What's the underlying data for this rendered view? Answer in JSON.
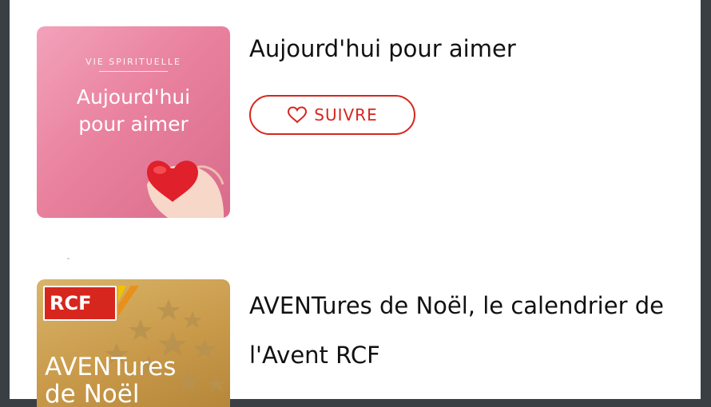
{
  "colors": {
    "accent": "#d7261e",
    "background": "#ffffff",
    "frame": "#3a3f44",
    "title_text": "#111111"
  },
  "podcasts": [
    {
      "title": "Aujourd'hui pour aimer",
      "cover": {
        "kicker": "VIE SPIRITUELLE",
        "title_line1": "Aujourd'hui",
        "title_line2": "pour aimer"
      },
      "follow_label": "SUIVRE",
      "follow_icon": "heart-outline-icon"
    },
    {
      "title": "AVENTures de Noël, le calendrier de l'Avent  RCF",
      "cover": {
        "logo_text": "RCF",
        "title_line1": "AVENTures",
        "title_line2": "de Noël"
      }
    }
  ]
}
